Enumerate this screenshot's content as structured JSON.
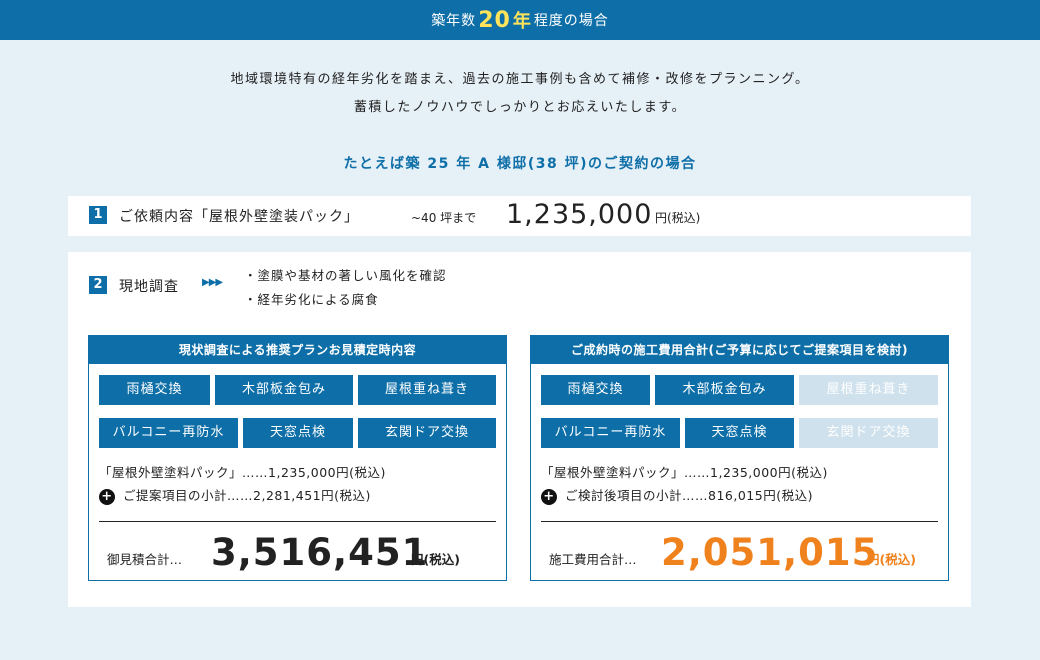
{
  "topbar": {
    "prefix": "築年数",
    "number": "20",
    "unit": "年",
    "suffix": "程度の場合"
  },
  "intro": {
    "line1": "地域環境特有の経年劣化を踏まえ、過去の施工事例も含めて補修・改修をプランニング。",
    "line2": "蓄積したノウハウでしっかりとお応えいたします。"
  },
  "subhead": "たとえば築 25 年 A 様邸(38 坪)のご契約の場合",
  "step1": {
    "num": "1",
    "label": "ご依頼内容「屋根外壁塗装パック」",
    "upto": "~40 坪まで",
    "price": "1,235,000",
    "tax": "円(税込)"
  },
  "step2": {
    "num": "2",
    "label": "現地調査",
    "arrows": "▶▶▶",
    "findings": [
      "・塗膜や基材の著しい風化を確認",
      "・経年劣化による腐食"
    ]
  },
  "left_panel": {
    "header": "現状調査による推奨プランお見積定時内容",
    "tags": [
      "雨樋交換",
      "木部板金包み",
      "屋根重ね葺き",
      "バルコニー再防水",
      "天窓点検",
      "玄関ドア交換"
    ],
    "line1_name": "「屋根外壁塗料パック」……",
    "line1_price": "1,235,000",
    "line1_tax": "円(税込)",
    "line2_name": "ご提案項目の小計……",
    "line2_price": "2,281,451",
    "line2_tax": "円(税込)",
    "total_label": "御見積合計…",
    "total": "3,516,451",
    "total_tax": "円(税込)"
  },
  "right_panel": {
    "header": "ご成約時の施工費用合計(ご予算に応じてご提案項目を検討)",
    "tags": [
      "雨樋交換",
      "木部板金包み",
      "屋根重ね葺き",
      "バルコニー再防水",
      "天窓点検",
      "玄関ドア交換"
    ],
    "line1_name": "「屋根外壁塗料パック」……",
    "line1_price": "1,235,000",
    "line1_tax": "円(税込)",
    "line2_name": "ご検討後項目の小計……",
    "line2_price": "816,015",
    "line2_tax": "円(税込)",
    "total_label": "施工費用合計…",
    "total": "2,051,015",
    "total_tax": "円(税込)"
  },
  "colors": {
    "accent": "#0e6fa8",
    "highlight": "#ffe35a",
    "orange": "#f0821e",
    "faded": "#cfe1ec",
    "background": "#e6f0f7"
  },
  "icons": {
    "plus": "plus-circle-icon",
    "connector": "arrow-right-circle-icon",
    "arrows": "triple-arrow-icon"
  }
}
